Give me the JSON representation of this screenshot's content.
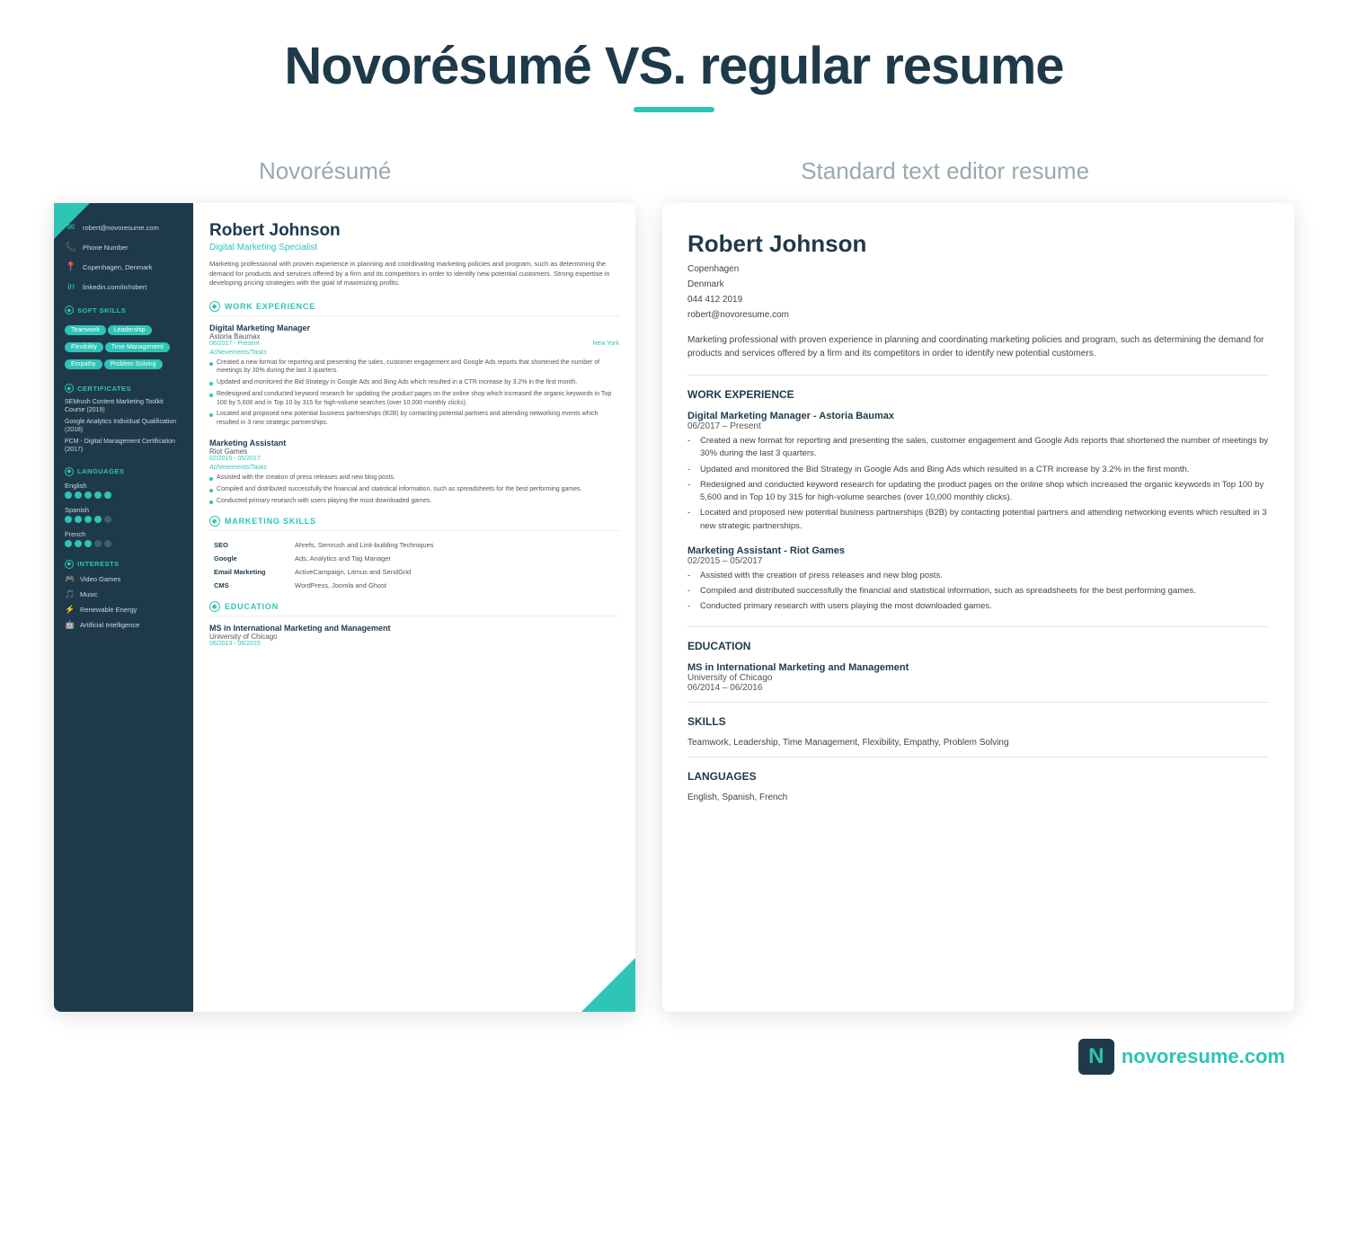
{
  "header": {
    "title": "Novorésumé VS. regular resume",
    "left_label": "Novorésumé",
    "right_label": "Standard text editor resume"
  },
  "novoresume": {
    "sidebar": {
      "email": "robert@novoresume.com",
      "phone": "Phone Number",
      "location": "Copenhagen, Denmark",
      "linkedin": "linkedin.com/in/robert",
      "soft_skills_title": "SOFT SKILLS",
      "skills": [
        "Teamwork",
        "Leadership",
        "Flexibility",
        "Time Management",
        "Empathy",
        "Problem Solving"
      ],
      "certificates_title": "CERTIFICATES",
      "certificates": [
        "SEMrush Content Marketing Toolkit Course (2019)",
        "Google Analytics Individual Qualification (2018)",
        "PCM - Digital Management Certification (2017)"
      ],
      "languages_title": "LANGUAGES",
      "languages": [
        {
          "name": "English",
          "level": 5
        },
        {
          "name": "Spanish",
          "level": 4
        },
        {
          "name": "French",
          "level": 3
        }
      ],
      "interests_title": "INTERESTS",
      "interests": [
        "Video Games",
        "Music",
        "Renewable Energy",
        "Artificial Intelligence"
      ]
    },
    "main": {
      "name": "Robert Johnson",
      "title": "Digital Marketing Specialist",
      "summary": "Marketing professional with proven experience in planning and coordinating marketing policies and program, such as determining the demand for products and services offered by a firm and its competitors in order to identify new potential customers. Strong expertise in developing pricing strategies with the goal of maximizing profits.",
      "work_experience_title": "WORK EXPERIENCE",
      "jobs": [
        {
          "role": "Digital Marketing Manager",
          "company": "Astoria Baumax",
          "dates": "06/2017 - Present",
          "location": "New York",
          "subtitle": "Achievements/Tasks",
          "bullets": [
            "Created a new format for reporting and presenting the sales, customer engagement and Google Ads reports that shortened the number of meetings by 30% during the last 3 quarters.",
            "Updated and monitored the Bid Strategy in Google Ads and Bing Ads which resulted in a CTR increase by 3.2% in the first month.",
            "Redesigned and conducted keyword research for updating the product pages on the online shop which increased the organic keywords in Top 100 by 5,600 and in Top 10 by 315 for high-volume searches (over 10,000 monthly clicks).",
            "Located and proposed new potential business partnerships (B2B) by contacting potential partners and attending networking events which resulted in 3 new strategic partnerships."
          ]
        },
        {
          "role": "Marketing Assistant",
          "company": "Riot Games",
          "dates": "02/2015 - 05/2017",
          "subtitle": "Achievements/Tasks",
          "bullets": [
            "Assisted with the creation of press releases and new blog posts.",
            "Compiled and distributed successfully the financial and statistical information, such as spreadsheets for the best performing games.",
            "Conducted primary research with users playing the most downloaded games."
          ]
        }
      ],
      "marketing_skills_title": "MARKETING SKILLS",
      "marketing_skills": [
        {
          "skill": "SEO",
          "detail": "Ahrefs, Semrush and Link-building Techniques"
        },
        {
          "skill": "Google",
          "detail": "Ads, Analytics and Tag Manager"
        },
        {
          "skill": "Email Marketing",
          "detail": "ActiveCampaign, Litmus and SendGrid"
        },
        {
          "skill": "CMS",
          "detail": "WordPress, Joomla and Ghost"
        }
      ],
      "education_title": "EDUCATION",
      "education": [
        {
          "degree": "MS in International Marketing and Management",
          "school": "University of Chicago",
          "dates": "06/2013 - 06/2015"
        }
      ]
    }
  },
  "standard": {
    "name": "Robert Johnson",
    "contact_lines": [
      "Copenhagen",
      "Denmark",
      "044 412 2019",
      "robert@novoresume.com"
    ],
    "summary": "Marketing professional with proven experience in planning and coordinating marketing policies and program, such as determining the demand for products and services offered by a firm and its competitors in order to identify new potential customers.",
    "work_experience_title": "WORK EXPERIENCE",
    "jobs": [
      {
        "role": "Digital Marketing Manager - Astoria Baumax",
        "dates": "06/2017 – Present",
        "bullets": [
          "Created a new format for reporting and presenting the sales, customer engagement and Google Ads reports that shortened the number of meetings by 30% during the last 3 quarters.",
          "Updated and monitored the Bid Strategy in Google Ads and Bing Ads which resulted in a CTR increase by 3.2% in the first month.",
          "Redesigned and conducted keyword research for updating the product pages on the online shop which increased the organic keywords in Top 100 by 5,600 and in Top 10 by 315 for high-volume searches (over 10,000 monthly clicks).",
          "Located and proposed new potential business partnerships (B2B) by contacting potential partners and attending networking events which resulted in 3 new strategic partnerships."
        ]
      },
      {
        "role": "Marketing Assistant - Riot Games",
        "dates": "02/2015 – 05/2017",
        "bullets": [
          "Assisted with the creation of press releases and new blog posts.",
          "Compiled and distributed successfully the financial and statistical information, such as spreadsheets for the best performing games.",
          "Conducted primary research with users playing the most downloaded games."
        ]
      }
    ],
    "education_title": "EDUCATION",
    "education": [
      {
        "degree": "MS in International Marketing and Management",
        "school": "University of Chicago",
        "dates": "06/2014 – 06/2016"
      }
    ],
    "skills_title": "SKILLS",
    "skills_text": "Teamwork, Leadership, Time Management, Flexibility, Empathy, Problem Solving",
    "languages_title": "LANGUAGES",
    "languages_text": "English, Spanish, French"
  },
  "footer": {
    "domain": "novoresume",
    "tld": ".com"
  }
}
